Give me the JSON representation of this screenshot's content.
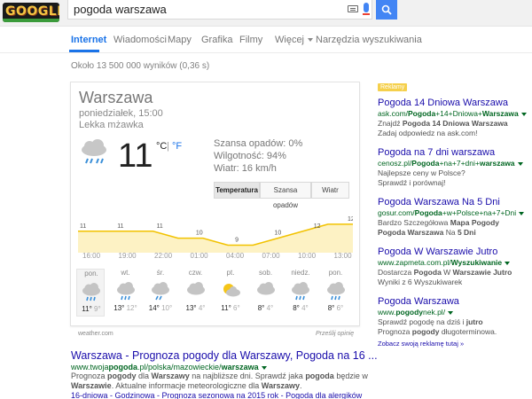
{
  "header": {
    "logo_text": "GOOGLE",
    "query": "pogoda warszawa",
    "keyboard_icon": "keyboard-icon",
    "mic_icon": "microphone-icon",
    "search_icon": "search-icon",
    "brand_color": "#4285f4"
  },
  "tabs": [
    {
      "label": "Internet",
      "active": true
    },
    {
      "label": "Wiadomości"
    },
    {
      "label": "Mapy"
    },
    {
      "label": "Grafika"
    },
    {
      "label": "Filmy"
    },
    {
      "label": "Więcej"
    },
    {
      "label": "Narzędzia wyszukiwania"
    }
  ],
  "result_stats": "Około 13 500 000 wyników (0,36 s)",
  "weather": {
    "city": "Warszawa",
    "date": "poniedziałek, 15:00",
    "condition": "Lekka mżawka",
    "condition_icon": "drizzle-icon",
    "temp": "11",
    "unit_c": "°C",
    "unit_sep": "|",
    "unit_f": "°F",
    "precip": "Szansa opadów: 0%",
    "humidity": "Wilgotność: 94%",
    "wind": "Wiatr: 16 km/h",
    "tabs": [
      "Temperatura",
      "Szansa opadów",
      "Wiatr"
    ],
    "source": "weather.com",
    "feedback": "Prześlij opinię"
  },
  "chart_data": {
    "type": "area",
    "x": [
      "16:00",
      "18:00",
      "20:00",
      "22:00",
      "00:00",
      "02:00",
      "04:00",
      "06:00",
      "08:00",
      "10:00",
      "12:00",
      "14:00"
    ],
    "values": [
      11,
      11,
      11,
      11,
      10,
      10,
      9,
      9,
      10,
      11,
      12,
      12
    ],
    "point_labels": [
      "11",
      "11",
      "11",
      "10",
      "9",
      "10",
      "12",
      "12"
    ],
    "tick_labels": [
      "16:00",
      "19:00",
      "22:00",
      "01:00",
      "04:00",
      "07:00",
      "10:00",
      "13:00"
    ],
    "ylim": [
      0,
      13
    ],
    "line_color": "#f2c200",
    "fill_color": "#fdf2c4"
  },
  "forecast": [
    {
      "day": "pon.",
      "icon": "rain-cloud-icon",
      "hi": "11°",
      "lo": "9°"
    },
    {
      "day": "wt.",
      "icon": "rain-cloud-icon",
      "hi": "13°",
      "lo": "12°"
    },
    {
      "day": "śr.",
      "icon": "showers-icon",
      "hi": "14°",
      "lo": "10°"
    },
    {
      "day": "czw.",
      "icon": "cloudy-icon",
      "hi": "13°",
      "lo": "4°"
    },
    {
      "day": "pt.",
      "icon": "partly-sunny-icon",
      "hi": "11°",
      "lo": "6°"
    },
    {
      "day": "sob.",
      "icon": "cloudy-icon",
      "hi": "8°",
      "lo": "4°"
    },
    {
      "day": "niedz.",
      "icon": "rain-cloud-icon",
      "hi": "8°",
      "lo": "4°"
    },
    {
      "day": "pon.",
      "icon": "rain-cloud-icon",
      "hi": "8°",
      "lo": "6°"
    }
  ],
  "organic": {
    "title": "Warszawa - Prognoza pogody dla Warszawy, Pogoda na 16 ...",
    "url": "www.twojapogoda.pl/polska/mazowieckie/warszawa",
    "snippet1": "Prognoza pogody dla Warszawy na najbliższe dni. Sprawdź jaka pogoda będzie w",
    "snippet2": "Warszawie. Aktualne informacje meteorologiczne dla Warszawy.",
    "links": "16-dniowa - Godzinowa - Prognoza sezonowa na 2015 rok - Pogoda dla alergików"
  },
  "ads": {
    "badge": "Reklamy",
    "items": [
      {
        "title": "Pogoda 14 Dniowa Warszawa",
        "url": "ask.com/Pogoda+14+Dniowa+Warszawa",
        "lines": [
          "Znajdź Pogoda 14 Dniowa Warszawa",
          "Zadaj odpowiedz na ask.com!"
        ]
      },
      {
        "title": "Pogoda na 7 dni warszawa",
        "url": "cenosz.pl/Pogoda+na+7+dni+warszawa",
        "lines": [
          "Najlepsze ceny w Polsce?",
          "Sprawdź i porównaj!"
        ]
      },
      {
        "title": "Pogoda Warszawa Na 5 Dni",
        "url": "gosur.com/Pogoda+w+Polsce+na+7+Dni",
        "lines": [
          "Bardzo Szczegółowa Mapa Pogody",
          "Pogoda Warszawa Na 5 Dni"
        ]
      },
      {
        "title": "Pogoda W Warszawie Jutro",
        "url": "www.zapmeta.com.pl/Wyszukiwanie",
        "lines": [
          "Dostarcza Pogoda W Warszawie Jutro",
          "Wyniki z 6 Wyszukiwarek"
        ]
      },
      {
        "title": "Pogoda Warszawa",
        "url": "www.pogodynek.pl/",
        "lines": [
          "Sprawdź pogodę na dziś i jutro",
          "Prognoza pogody długoterminowa."
        ]
      }
    ],
    "footer": "Zobacz swoją reklamę tutaj »"
  }
}
